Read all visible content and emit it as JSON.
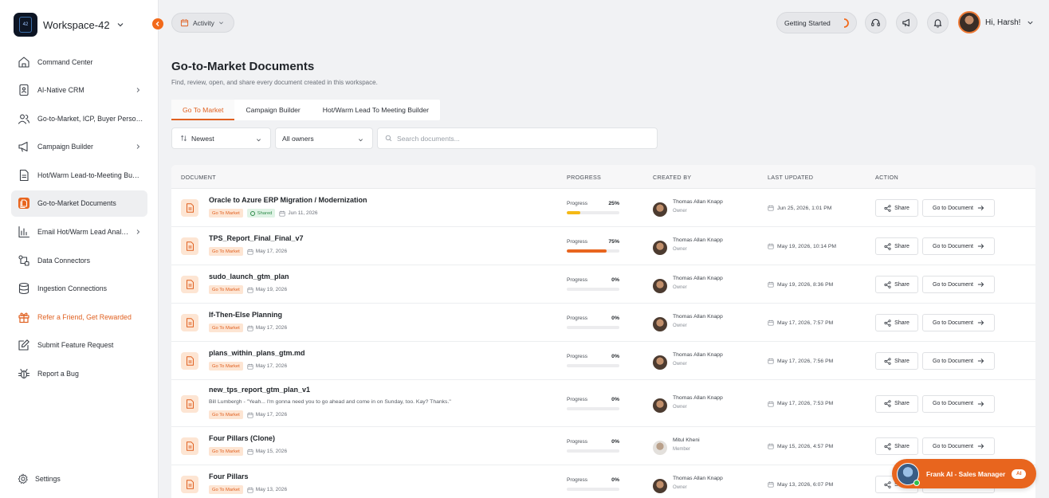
{
  "workspace": {
    "name": "Workspace-42",
    "logo_text": "42"
  },
  "sidebar": {
    "items": [
      {
        "label": "Command Center",
        "icon": "home-icon",
        "has_chevron": false,
        "active": false,
        "highlight": false
      },
      {
        "label": "AI-Native CRM",
        "icon": "contact-card-icon",
        "has_chevron": true,
        "active": false,
        "highlight": false
      },
      {
        "label": "Go-to-Market, ICP, Buyer Perso…",
        "icon": "users-icon",
        "has_chevron": false,
        "active": false,
        "highlight": false
      },
      {
        "label": "Campaign Builder",
        "icon": "megaphone-icon",
        "has_chevron": true,
        "active": false,
        "highlight": false
      },
      {
        "label": "Hot/Warm Lead-to-Meeting Bu…",
        "icon": "document-icon",
        "has_chevron": false,
        "active": false,
        "highlight": false
      },
      {
        "label": "Go-to-Market Documents",
        "icon": "documents-icon",
        "has_chevron": false,
        "active": true,
        "highlight": false
      },
      {
        "label": "Email Hot/Warm Lead Anal…",
        "icon": "bar-chart-icon",
        "has_chevron": true,
        "active": false,
        "highlight": false
      },
      {
        "label": "Data Connectors",
        "icon": "connectors-icon",
        "has_chevron": false,
        "active": false,
        "highlight": false
      },
      {
        "label": "Ingestion Connections",
        "icon": "database-icon",
        "has_chevron": false,
        "active": false,
        "highlight": false
      },
      {
        "label": "Refer a Friend, Get Rewarded",
        "icon": "gift-icon",
        "has_chevron": false,
        "active": false,
        "highlight": true
      },
      {
        "label": "Submit Feature Request",
        "icon": "edit-icon",
        "has_chevron": false,
        "active": false,
        "highlight": false
      },
      {
        "label": "Report a Bug",
        "icon": "bug-icon",
        "has_chevron": false,
        "active": false,
        "highlight": false
      }
    ],
    "settings_label": "Settings"
  },
  "topbar": {
    "activity_label": "Activity",
    "getting_started_label": "Getting Started",
    "greeting": "Hi, Harsh!"
  },
  "page": {
    "title": "Go-to-Market Documents",
    "subtitle": "Find, review, open, and share every document created in this workspace.",
    "tabs": [
      "Go To Market",
      "Campaign Builder",
      "Hot/Warm Lead To Meeting Builder"
    ],
    "active_tab": 0,
    "filters": {
      "sort_value": "Newest",
      "owner_value": "All owners",
      "search_placeholder": "Search documents..."
    }
  },
  "table": {
    "headers": {
      "document": "DOCUMENT",
      "progress": "PROGRESS",
      "created_by": "CREATED BY",
      "last_updated": "LAST UPDATED",
      "action": "ACTION"
    },
    "progress_label": "Progress",
    "share_label": "Share",
    "go_label": "Go to Document",
    "rows": [
      {
        "title": "Oracle to Azure ERP Migration / Modernization",
        "tag": "Go To Market",
        "shared": "Shared",
        "quote": "",
        "date": "Jun 11, 2026",
        "progress": 25,
        "progress_text": "25%",
        "owner": "Thomas Allan Knapp",
        "role": "Owner",
        "avatar": "a",
        "updated": "Jun 25, 2026, 1:01 PM"
      },
      {
        "title": "TPS_Report_Final_Final_v7",
        "tag": "Go To Market",
        "shared": "",
        "quote": "",
        "date": "May 17, 2026",
        "progress": 75,
        "progress_text": "75%",
        "owner": "Thomas Allan Knapp",
        "role": "Owner",
        "avatar": "a",
        "updated": "May 19, 2026, 10:14 PM"
      },
      {
        "title": "sudo_launch_gtm_plan",
        "tag": "Go To Market",
        "shared": "",
        "quote": "",
        "date": "May 19, 2026",
        "progress": 0,
        "progress_text": "0%",
        "owner": "Thomas Allan Knapp",
        "role": "Owner",
        "avatar": "a",
        "updated": "May 19, 2026, 8:36 PM"
      },
      {
        "title": "If-Then-Else Planning",
        "tag": "Go To Market",
        "shared": "",
        "quote": "",
        "date": "May 17, 2026",
        "progress": 0,
        "progress_text": "0%",
        "owner": "Thomas Allan Knapp",
        "role": "Owner",
        "avatar": "a",
        "updated": "May 17, 2026, 7:57 PM"
      },
      {
        "title": "plans_within_plans_gtm.md",
        "tag": "Go To Market",
        "shared": "",
        "quote": "",
        "date": "May 17, 2026",
        "progress": 0,
        "progress_text": "0%",
        "owner": "Thomas Allan Knapp",
        "role": "Owner",
        "avatar": "a",
        "updated": "May 17, 2026, 7:56 PM"
      },
      {
        "title": "new_tps_report_gtm_plan_v1",
        "tag": "Go To Market",
        "shared": "",
        "quote": "Bill Lumbergh - \"Yeah... I'm gonna need you to go ahead and come in on Sunday, too. Kay? Thanks.\"",
        "date": "May 17, 2026",
        "progress": 0,
        "progress_text": "0%",
        "owner": "Thomas Allan Knapp",
        "role": "Owner",
        "avatar": "a",
        "updated": "May 17, 2026, 7:53 PM"
      },
      {
        "title": "Four Pillars (Clone)",
        "tag": "Go To Market",
        "shared": "",
        "quote": "",
        "date": "May 15, 2026",
        "progress": 0,
        "progress_text": "0%",
        "owner": "Mitul Kheni",
        "role": "Member",
        "avatar": "b",
        "updated": "May 15, 2026, 4:57 PM"
      },
      {
        "title": "Four Pillars",
        "tag": "Go To Market",
        "shared": "",
        "quote": "",
        "date": "May 13, 2026",
        "progress": 0,
        "progress_text": "0%",
        "owner": "Thomas Allan Knapp",
        "role": "Owner",
        "avatar": "a",
        "updated": "May 13, 2026, 6:07 PM"
      }
    ]
  },
  "ai_assistant": {
    "name": "Frank AI - Sales Manager",
    "badge": "AI"
  },
  "colors": {
    "accent": "#e06020",
    "progress_low": "#f5b915",
    "progress_high": "#e8651e"
  }
}
